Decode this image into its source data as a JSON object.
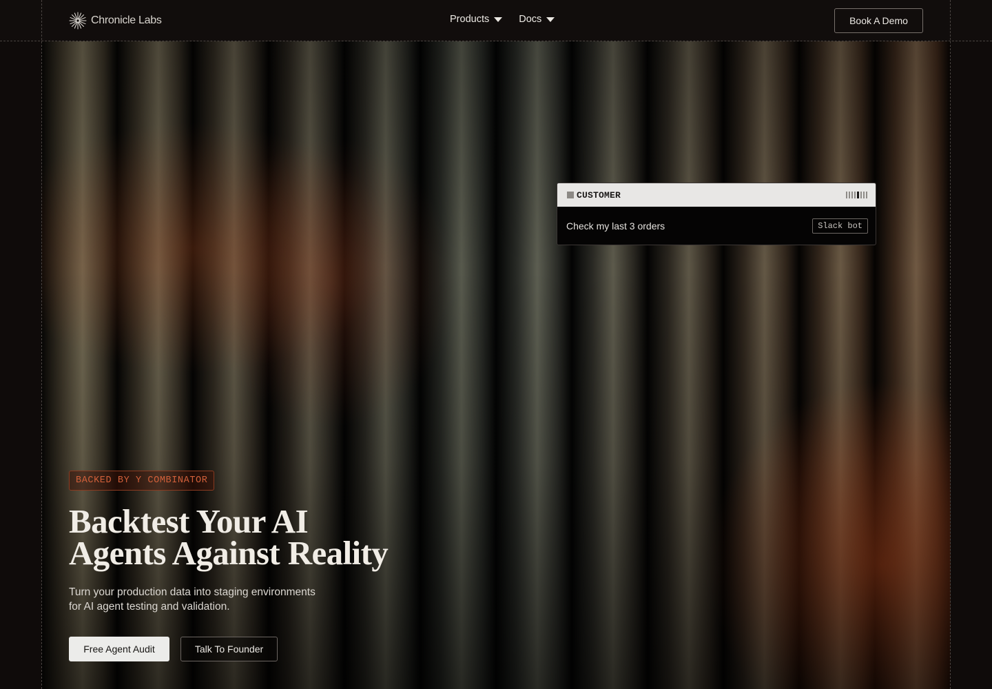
{
  "header": {
    "logo_text": "Chronicle Labs",
    "nav": [
      {
        "label": "Products"
      },
      {
        "label": "Docs"
      }
    ],
    "demo_button": "Book A Demo"
  },
  "card": {
    "label": "CUSTOMER",
    "message": "Check my last 3 orders",
    "tag": "Slack bot"
  },
  "hero": {
    "badge": "BACKED BY Y COMBINATOR",
    "headline_line1": "Backtest Your AI",
    "headline_line2": "Agents Against Reality",
    "subtitle_line1": "Turn your production data into staging environments",
    "subtitle_line2": "for AI agent testing and validation.",
    "primary_button": "Free Agent Audit",
    "secondary_button": "Talk To Founder"
  },
  "colors": {
    "background": "#0f0b0a",
    "badge_accent": "#d2603a",
    "card_header": "#e8e7e5",
    "primary_button": "#ececea"
  },
  "icons": {
    "logo": "starburst-icon",
    "nav_caret": "caret-down-icon",
    "card_marker": "square-icon",
    "card_indicator": "signal-bars-icon"
  }
}
